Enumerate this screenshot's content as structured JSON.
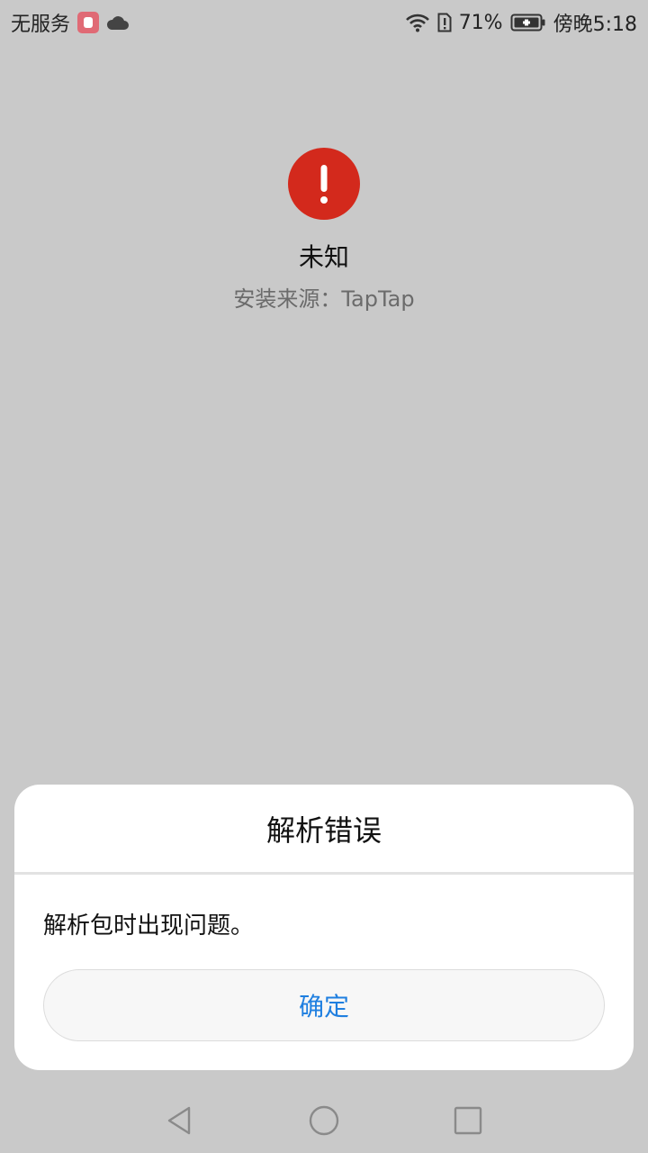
{
  "status_bar": {
    "carrier": "无服务",
    "battery_percent": "71%",
    "time": "傍晚5:18",
    "icons": [
      "app-notification-icon",
      "cloud-icon",
      "wifi-icon",
      "sim-alert-icon",
      "battery-icon"
    ]
  },
  "app": {
    "name": "未知",
    "install_source": "安装来源：TapTap",
    "error_icon_color": "#d3291c"
  },
  "dialog": {
    "title": "解析错误",
    "message": "解析包时出现问题。",
    "confirm_label": "确定",
    "confirm_color": "#1f7fe0"
  },
  "nav_bar": {
    "icons": [
      "back-icon",
      "home-icon",
      "recents-icon"
    ]
  }
}
